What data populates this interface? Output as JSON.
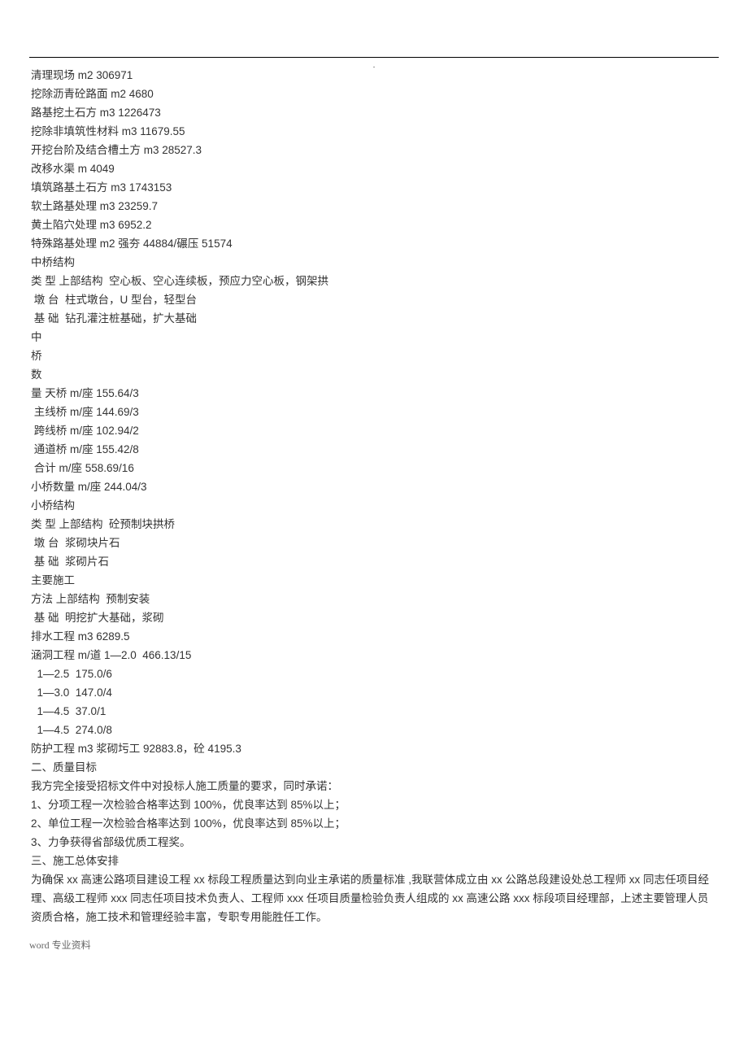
{
  "topMark": ".",
  "lines": [
    "清理现场 m2 306971",
    "挖除沥青砼路面 m2 4680",
    "路基挖土石方 m3 1226473",
    "挖除非填筑性材料 m3 11679.55",
    "开挖台阶及结合槽土方 m3 28527.3",
    "改移水渠 m 4049",
    "填筑路基土石方 m3 1743153",
    "软土路基处理 m3 23259.7",
    "黄土陷穴处理 m3 6952.2",
    "特殊路基处理 m2 强夯 44884/碾压 51574",
    "中桥结构",
    "类 型 上部结构  空心板、空心连续板，预应力空心板，钢架拱",
    " 墩 台  柱式墩台，U 型台，轻型台",
    " 基 础  钻孔灌注桩基础，扩大基础",
    "中",
    "桥",
    "数",
    "量 天桥 m/座 155.64/3",
    " 主线桥 m/座 144.69/3",
    " 跨线桥 m/座 102.94/2",
    " 通道桥 m/座 155.42/8",
    " 合计 m/座 558.69/16",
    "小桥数量 m/座 244.04/3",
    "小桥结构",
    "类 型 上部结构  砼预制块拱桥",
    " 墩 台  浆砌块片石",
    " 基 础  浆砌片石",
    "主要施工",
    "方法 上部结构  预制安装",
    " 基 础  明挖扩大基础，浆砌",
    "排水工程 m3 6289.5",
    "涵洞工程 m/道 1—2.0  466.13/15",
    "  1—2.5  175.0/6",
    "  1—3.0  147.0/4",
    "  1—4.5  37.0/1",
    "  1—4.5  274.0/8",
    "防护工程 m3 浆砌圬工 92883.8，砼 4195.3",
    "二、质量目标",
    "我方完全接受招标文件中对投标人施工质量的要求，同时承诺：",
    "1、分项工程一次检验合格率达到 100%，优良率达到 85%以上；",
    "2、单位工程一次检验合格率达到 100%，优良率达到 85%以上；",
    "3、力争获得省部级优质工程奖。",
    "三、施工总体安排",
    "为确保 xx 高速公路项目建设工程 xx 标段工程质量达到向业主承诺的质量标准 ,我联营体成立由 xx 公路总段建设处总工程师 xx 同志任项目经理、高级工程师 xxx 同志任项目技术负责人、工程师 xxx 任项目质量检验负责人组成的 xx 高速公路 xxx 标段项目经理部，上述主要管理人员资质合格，施工技术和管理经验丰富，专职专用能胜任工作。"
  ],
  "footer": "word 专业资料"
}
